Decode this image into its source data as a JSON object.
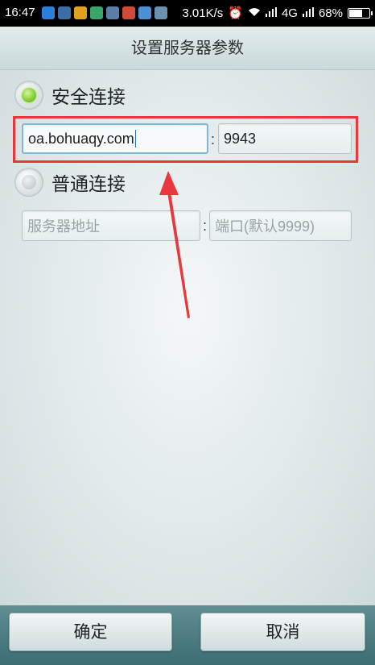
{
  "status_bar": {
    "time": "16:47",
    "net_speed": "3.01K/s",
    "network": "4G",
    "battery": "68%",
    "battery_level": 0.68,
    "notification_icons": [
      {
        "name": "messenger-icon",
        "color": "#2b7fd6"
      },
      {
        "name": "app-icon",
        "color": "#3b6ea5"
      },
      {
        "name": "colorful-app-icon",
        "color": "#e0a020"
      },
      {
        "name": "scan-icon",
        "color": "#3aa66b"
      },
      {
        "name": "app-icon-2",
        "color": "#5a7ea8"
      },
      {
        "name": "camera-icon",
        "color": "#d24a3a"
      },
      {
        "name": "upload-icon",
        "color": "#4d8fd6"
      },
      {
        "name": "app-icon-3",
        "color": "#6b8fb0"
      }
    ]
  },
  "title": "设置服务器参数",
  "secure_connection": {
    "label": "安全连接",
    "selected": true,
    "server_value": "oa.bohuaqy.com",
    "port_value": "9943"
  },
  "normal_connection": {
    "label": "普通连接",
    "selected": false,
    "server_placeholder": "服务器地址",
    "port_placeholder": "端口(默认9999)"
  },
  "separator": ":",
  "buttons": {
    "ok": "确定",
    "cancel": "取消"
  },
  "annotation": {
    "box_color": "#e8383e",
    "arrow_color": "#e8383e"
  }
}
